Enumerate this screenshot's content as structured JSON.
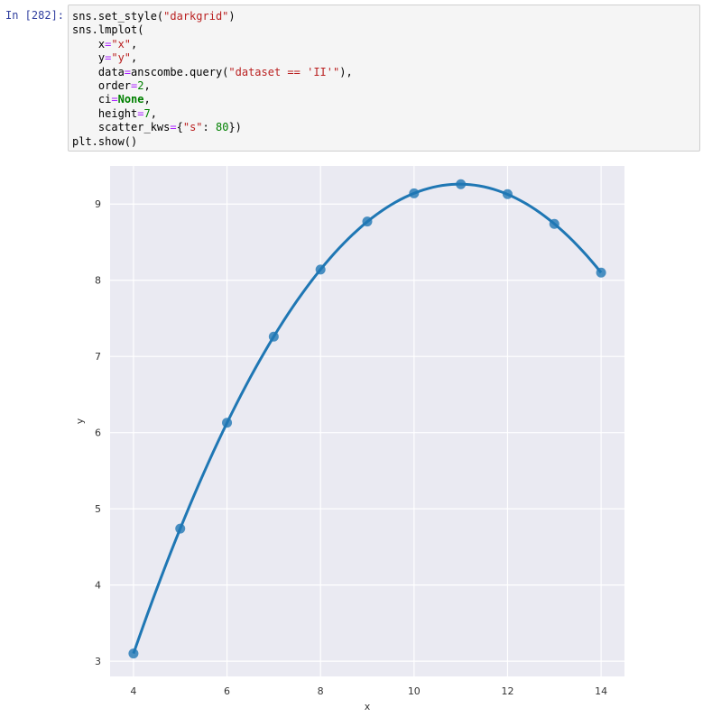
{
  "cell": {
    "prompt": "In [282]:",
    "code_lines": [
      [
        {
          "t": "sns.set_style("
        },
        {
          "t": "\"darkgrid\"",
          "c": "str"
        },
        {
          "t": ")"
        }
      ],
      [
        {
          "t": "sns.lmplot("
        }
      ],
      [
        {
          "t": "    x"
        },
        {
          "t": "=",
          "c": "op"
        },
        {
          "t": "\"x\"",
          "c": "str"
        },
        {
          "t": ","
        }
      ],
      [
        {
          "t": "    y"
        },
        {
          "t": "=",
          "c": "op"
        },
        {
          "t": "\"y\"",
          "c": "str"
        },
        {
          "t": ","
        }
      ],
      [
        {
          "t": "    data"
        },
        {
          "t": "=",
          "c": "op"
        },
        {
          "t": "anscombe.query("
        },
        {
          "t": "\"dataset == 'II'\"",
          "c": "str"
        },
        {
          "t": "),"
        }
      ],
      [
        {
          "t": "    order"
        },
        {
          "t": "=",
          "c": "op"
        },
        {
          "t": "2",
          "c": "num"
        },
        {
          "t": ","
        }
      ],
      [
        {
          "t": "    ci"
        },
        {
          "t": "=",
          "c": "op"
        },
        {
          "t": "None",
          "c": "kw"
        },
        {
          "t": ","
        }
      ],
      [
        {
          "t": "    height"
        },
        {
          "t": "=",
          "c": "op"
        },
        {
          "t": "7",
          "c": "num"
        },
        {
          "t": ","
        }
      ],
      [
        {
          "t": "    scatter_kws"
        },
        {
          "t": "=",
          "c": "op"
        },
        {
          "t": "{"
        },
        {
          "t": "\"s\"",
          "c": "str"
        },
        {
          "t": ": "
        },
        {
          "t": "80",
          "c": "num"
        },
        {
          "t": "})"
        }
      ],
      [
        {
          "t": "plt.show()"
        }
      ]
    ]
  },
  "chart_data": {
    "type": "scatter",
    "xlabel": "x",
    "ylabel": "y",
    "xlim": [
      3.5,
      14.5
    ],
    "ylim": [
      2.8,
      9.5
    ],
    "xticks": [
      4,
      6,
      8,
      10,
      12,
      14
    ],
    "yticks": [
      3,
      4,
      5,
      6,
      7,
      8,
      9
    ],
    "grid": true,
    "background": "#eaeaf2",
    "grid_color": "#ffffff",
    "series": [
      {
        "color": "#1f77b4",
        "x": [
          4,
          5,
          6,
          7,
          8,
          9,
          10,
          11,
          12,
          13,
          14
        ],
        "y": [
          3.1,
          4.74,
          6.13,
          7.26,
          8.14,
          8.77,
          9.14,
          9.26,
          9.13,
          8.74,
          8.1
        ]
      }
    ],
    "fit": {
      "order": 2,
      "color": "#1f77b4"
    }
  }
}
